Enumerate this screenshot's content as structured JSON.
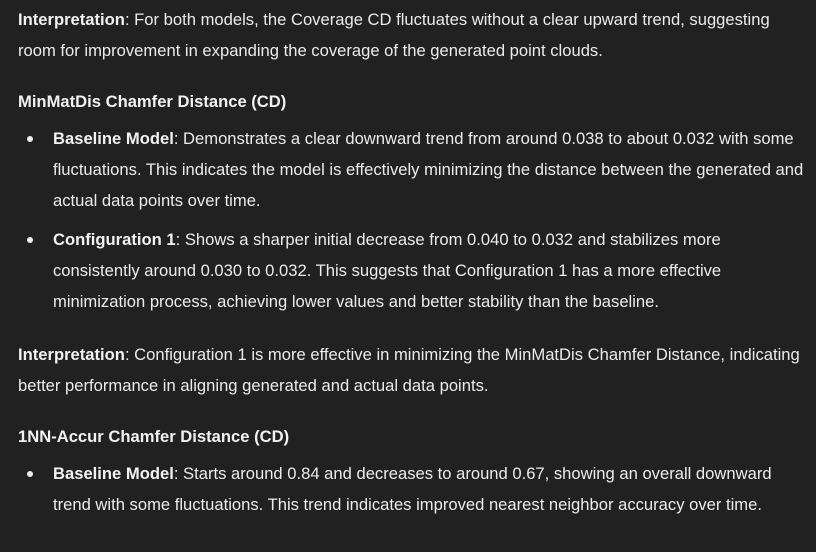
{
  "blocks": {
    "interp1": {
      "label": "Interpretation",
      "text": ": For both models, the Coverage CD fluctuates without a clear upward trend, suggesting room for improvement in expanding the coverage of the generated point clouds."
    },
    "section_minmatdis": {
      "heading": "MinMatDis Chamfer Distance (CD)",
      "items": [
        {
          "label": "Baseline Model",
          "text": ": Demonstrates a clear downward trend from around 0.038 to about 0.032 with some fluctuations. This indicates the model is effectively minimizing the distance between the generated and actual data points over time."
        },
        {
          "label": "Configuration 1",
          "text": ": Shows a sharper initial decrease from 0.040 to 0.032 and stabilizes more consistently around 0.030 to 0.032. This suggests that Configuration 1 has a more effective minimization process, achieving lower values and better stability than the baseline."
        }
      ]
    },
    "interp2": {
      "label": "Interpretation",
      "text": ": Configuration 1 is more effective in minimizing the MinMatDis Chamfer Distance, indicating better performance in aligning generated and actual data points."
    },
    "section_1nn": {
      "heading": "1NN-Accur Chamfer Distance (CD)",
      "items": [
        {
          "label": "Baseline Model",
          "text": ": Starts around 0.84 and decreases to around 0.67, showing an overall downward trend with some fluctuations. This trend indicates improved nearest neighbor accuracy over time."
        }
      ]
    }
  }
}
